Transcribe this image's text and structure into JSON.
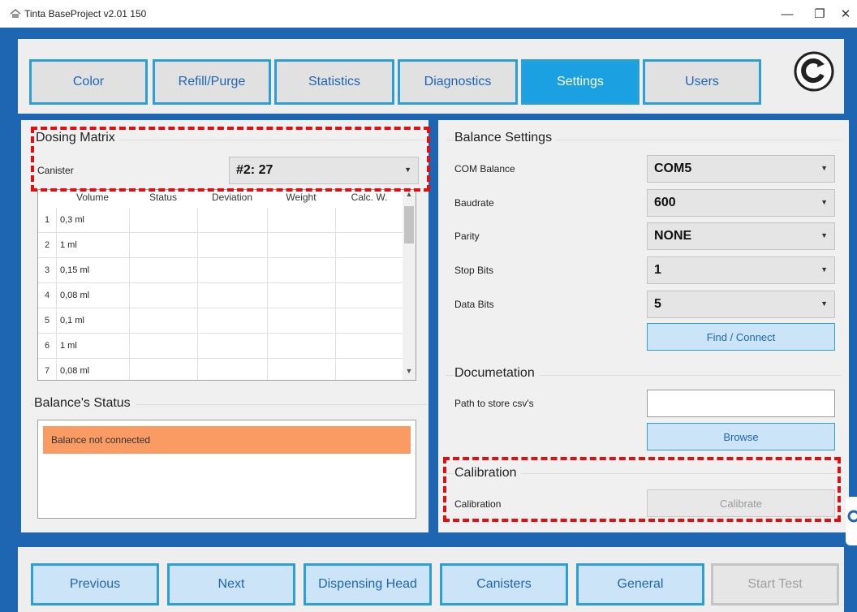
{
  "window": {
    "title": "Tinta BaseProject v2.01 150",
    "minimize": "—",
    "maximize": "❐",
    "close": "✕"
  },
  "nav": {
    "tabs": [
      {
        "label": "Color",
        "active": false
      },
      {
        "label": "Refill/Purge",
        "active": false
      },
      {
        "label": "Statistics",
        "active": false
      },
      {
        "label": "Diagnostics",
        "active": false
      },
      {
        "label": "Settings",
        "active": true
      },
      {
        "label": "Users",
        "active": false
      }
    ],
    "refresh_icon": "refresh-icon"
  },
  "dosing_matrix": {
    "title": "Dosing Matrix",
    "canister_label": "Canister",
    "canister_value": "#2: 27",
    "columns": [
      "Volume",
      "Status",
      "Deviation",
      "Weight",
      "Calc. W."
    ],
    "rows": [
      {
        "n": "1",
        "volume": "0,3 ml"
      },
      {
        "n": "2",
        "volume": "1 ml"
      },
      {
        "n": "3",
        "volume": "0,15 ml"
      },
      {
        "n": "4",
        "volume": "0,08 ml"
      },
      {
        "n": "5",
        "volume": "0,1 ml"
      },
      {
        "n": "6",
        "volume": "1 ml"
      },
      {
        "n": "7",
        "volume": "0,08 ml"
      }
    ]
  },
  "balance_status": {
    "title": "Balance's Status",
    "message": "Balance not connected",
    "message_color": "#f99b63"
  },
  "balance_settings": {
    "title": "Balance Settings",
    "com_label": "COM Balance",
    "com_value": "COM5",
    "baud_label": "Baudrate",
    "baud_value": "600",
    "parity_label": "Parity",
    "parity_value": "NONE",
    "stop_label": "Stop Bits",
    "stop_value": "1",
    "data_label": "Data Bits",
    "data_value": "5",
    "find_button": "Find / Connect"
  },
  "documentation": {
    "title": "Documetation",
    "path_label": "Path to store csv's",
    "path_value": "",
    "browse_button": "Browse"
  },
  "calibration": {
    "title": "Calibration",
    "label": "Calibration",
    "button": "Calibrate"
  },
  "footer": {
    "previous": "Previous",
    "next": "Next",
    "dispensing_head": "Dispensing Head",
    "canisters": "Canisters",
    "general": "General",
    "start_test": "Start Test"
  },
  "colors": {
    "accent": "#1e66b2",
    "tab_border": "#2c9fd6",
    "active_tab": "#1ba1e2",
    "highlight": "#e01010"
  }
}
